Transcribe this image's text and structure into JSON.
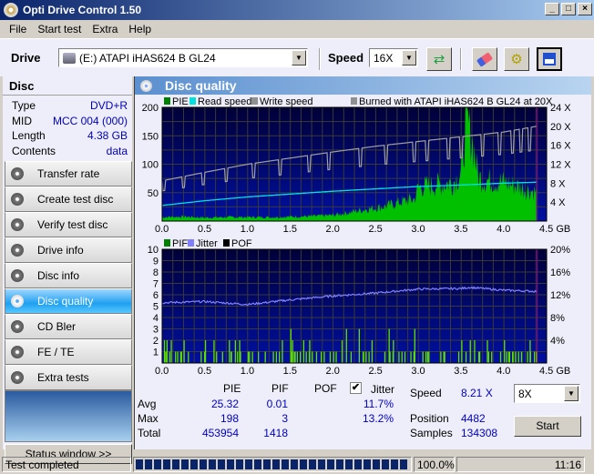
{
  "window": {
    "title": "Opti Drive Control 1.50",
    "minimize": "_",
    "maximize": "□",
    "close": "×"
  },
  "menu": [
    "File",
    "Start test",
    "Extra",
    "Help"
  ],
  "toolbar": {
    "drive_label": "Drive",
    "drive_value": "(E:)  ATAPI iHAS624   B GL24",
    "speed_label": "Speed",
    "speed_value": "16X",
    "icons": [
      "refresh-icon",
      "eraser-icon",
      "settings-icon",
      "save-icon"
    ]
  },
  "disc": {
    "title": "Disc",
    "rows": [
      {
        "k": "Type",
        "v": "DVD+R"
      },
      {
        "k": "MID",
        "v": "MCC 004 (000)"
      },
      {
        "k": "Length",
        "v": "4.38 GB"
      },
      {
        "k": "Contents",
        "v": "data"
      }
    ]
  },
  "nav": {
    "items": [
      "Transfer rate",
      "Create test disc",
      "Verify test disc",
      "Drive info",
      "Disc info",
      "Disc quality",
      "CD Bler",
      "FE / TE",
      "Extra tests"
    ],
    "active": 5,
    "status_window": "Status window >>"
  },
  "main": {
    "title": "Disc quality"
  },
  "chart_data": [
    {
      "type": "bar",
      "title": "PIE",
      "legend": [
        "PIE",
        "Read speed",
        "Write speed"
      ],
      "annotation": "Burned with ATAPI iHAS624   B GL24 at 20X",
      "xlabel": "GB",
      "x_ticks": [
        "0.0",
        "0.5",
        "1.0",
        "1.5",
        "2.0",
        "2.5",
        "3.0",
        "3.5",
        "4.0",
        "4.5 GB"
      ],
      "y_ticks": [
        "200",
        "150",
        "100",
        "50"
      ],
      "y2_ticks": [
        "24 X",
        "20 X",
        "16 X",
        "12 X",
        "8 X",
        "4 X"
      ],
      "xlim": [
        0,
        4.5
      ],
      "ylim": [
        0,
        200
      ],
      "y2lim": [
        0,
        24
      ],
      "colors": {
        "pie": "#00c000",
        "read": "#00e0e0",
        "write": "#a0a0a0",
        "bg_top": "#000040",
        "bg_bottom": "#0000a0",
        "end_marker": "#a000a0"
      },
      "series": [
        {
          "name": "PIE (envelope)",
          "x": [
            0,
            0.25,
            0.5,
            0.75,
            1.0,
            1.25,
            1.5,
            1.75,
            2.0,
            2.2,
            2.4,
            2.6,
            2.8,
            2.95,
            3.0,
            3.2,
            3.4,
            3.5,
            3.55,
            3.6,
            3.65,
            3.7,
            3.8,
            4.0,
            4.2,
            4.38
          ],
          "values": [
            8,
            9,
            7,
            8,
            8,
            8,
            9,
            10,
            12,
            18,
            25,
            30,
            40,
            45,
            70,
            75,
            80,
            100,
            190,
            195,
            150,
            90,
            85,
            80,
            70,
            60
          ]
        },
        {
          "name": "Read speed",
          "x": [
            0,
            0.5,
            1.0,
            1.5,
            2.0,
            2.5,
            3.0,
            3.5,
            4.0,
            4.38
          ],
          "values": [
            3.3,
            4.3,
            5.1,
            5.7,
            6.3,
            6.8,
            7.3,
            7.6,
            8.0,
            8.2
          ]
        },
        {
          "name": "Write speed",
          "x": [
            0,
            0.5,
            1.0,
            1.5,
            2.0,
            2.5,
            3.0,
            3.5,
            4.0,
            4.38
          ],
          "values": [
            8.5,
            10.3,
            12.0,
            13.3,
            14.6,
            15.8,
            16.8,
            17.8,
            18.8,
            20
          ]
        }
      ],
      "end_position_gb": 4.38
    },
    {
      "type": "bar",
      "title": "PIF / Jitter",
      "legend": [
        "PIF",
        "Jitter",
        "POF"
      ],
      "xlabel": "GB",
      "x_ticks": [
        "0.0",
        "0.5",
        "1.0",
        "1.5",
        "2.0",
        "2.5",
        "3.0",
        "3.5",
        "4.0",
        "4.5 GB"
      ],
      "y_ticks": [
        "10",
        "9",
        "8",
        "7",
        "6",
        "5",
        "4",
        "3",
        "2",
        "1"
      ],
      "y2_ticks": [
        "20%",
        "16%",
        "12%",
        "8%",
        "4%"
      ],
      "xlim": [
        0,
        4.5
      ],
      "ylim": [
        0,
        10
      ],
      "y2lim": [
        0,
        20
      ],
      "colors": {
        "pif": "#60e000",
        "jitter": "#8080ff",
        "pof": "#000000"
      },
      "series": [
        {
          "name": "Jitter (%)",
          "x": [
            0,
            0.5,
            1.0,
            1.5,
            2.0,
            2.5,
            3.0,
            3.5,
            3.6,
            4.0,
            4.38
          ],
          "values": [
            10.6,
            10.8,
            10.3,
            11.1,
            11.8,
            12.3,
            13.0,
            13.1,
            13.3,
            12.8,
            12.6
          ]
        },
        {
          "name": "PIF",
          "x": [
            0.02,
            0.05,
            0.08,
            0.1,
            0.15,
            0.22,
            0.25,
            0.3,
            0.45,
            0.5,
            0.6,
            0.78,
            0.8,
            0.85,
            0.9,
            1.0,
            1.2,
            1.4,
            1.5,
            1.52,
            1.55,
            1.65,
            1.72,
            1.8,
            2.0,
            2.1,
            2.15,
            2.3,
            2.35,
            2.45,
            2.6,
            2.65,
            2.7,
            2.8,
            2.95,
            3.1,
            3.3,
            3.5,
            3.55,
            3.6,
            3.65,
            3.7,
            3.8,
            3.85,
            4.0,
            4.05,
            4.1,
            4.2,
            4.3,
            4.35
          ],
          "values": [
            2,
            2,
            1,
            2,
            1,
            1,
            2,
            1,
            1,
            2,
            2,
            2,
            1,
            2,
            2,
            1,
            1,
            2,
            3,
            2,
            1,
            2,
            2,
            1,
            1,
            2,
            3,
            3,
            1,
            2,
            1,
            3,
            2,
            1,
            3,
            1,
            1,
            2,
            1,
            2,
            2,
            1,
            2,
            1,
            2,
            1,
            1,
            1,
            2,
            1
          ]
        }
      ],
      "end_position_gb": 4.38
    }
  ],
  "stats": {
    "headers": [
      "PIE",
      "PIF",
      "POF",
      "Jitter"
    ],
    "jitter_checked": true,
    "rows": [
      {
        "label": "Avg",
        "pie": "25.32",
        "pif": "0.01",
        "pof": "",
        "jitter": "11.7%"
      },
      {
        "label": "Max",
        "pie": "198",
        "pif": "3",
        "pof": "",
        "jitter": "13.2%"
      },
      {
        "label": "Total",
        "pie": "453954",
        "pif": "1418",
        "pof": "",
        "jitter": ""
      }
    ],
    "speed_label": "Speed",
    "speed_value": "8.21 X",
    "position_label": "Position",
    "position_value": "4482",
    "samples_label": "Samples",
    "samples_value": "134308",
    "speed_select": "8X",
    "start_label": "Start"
  },
  "statusbar": {
    "text": "Test completed",
    "progress": 1.0,
    "percent": "100.0%",
    "time": "11:16"
  }
}
